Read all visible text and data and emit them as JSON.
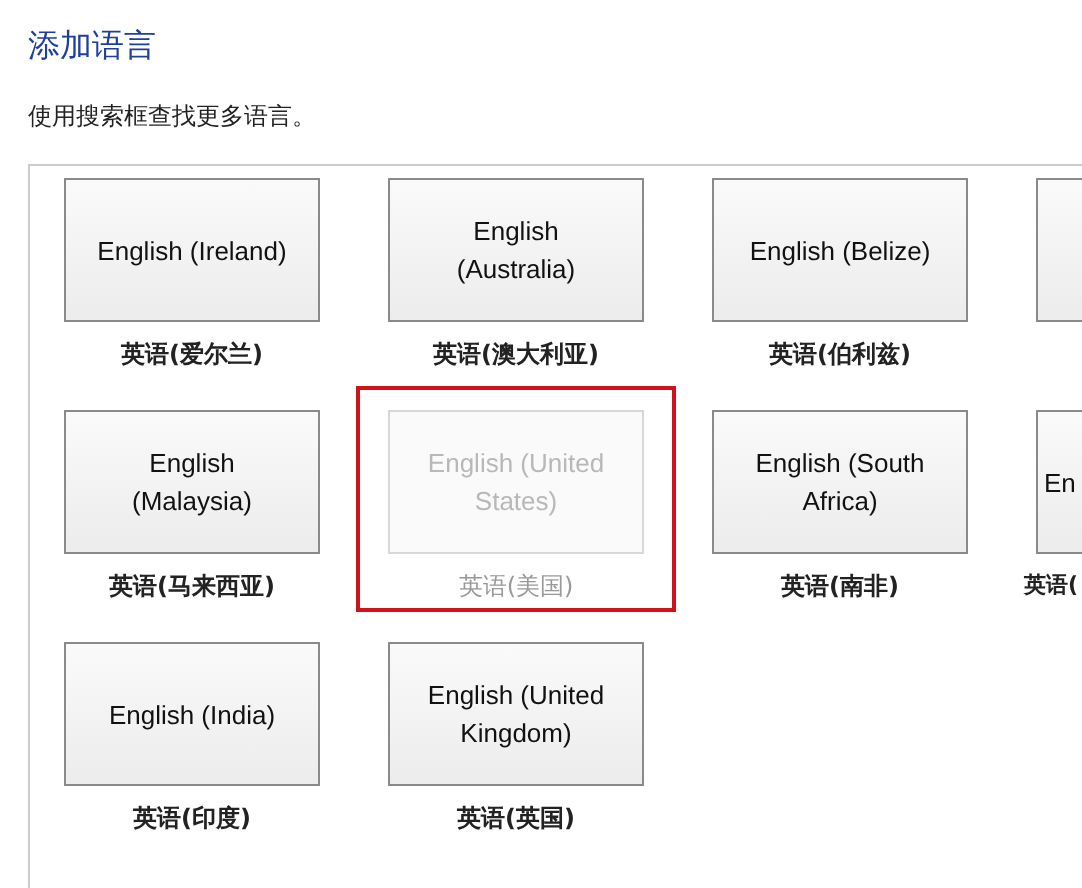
{
  "title": "添加语言",
  "instruction": "使用搜索框查找更多语言。",
  "languages": [
    {
      "kind": "full",
      "tile_text": "English (Ireland)",
      "caption": "英语(爱尔兰)",
      "disabled": false,
      "highlighted": false
    },
    {
      "kind": "full",
      "tile_text": "English (Australia)",
      "caption": "英语(澳大利亚)",
      "disabled": false,
      "highlighted": false
    },
    {
      "kind": "full",
      "tile_text": "English (Belize)",
      "caption": "英语(伯利兹)",
      "disabled": false,
      "highlighted": false
    },
    {
      "kind": "partial",
      "disabled": false,
      "highlighted": false
    },
    {
      "kind": "full",
      "tile_text": "English (Malaysia)",
      "caption": "英语(马来西亚)",
      "disabled": false,
      "highlighted": false
    },
    {
      "kind": "full",
      "tile_text": "English (United States)",
      "caption": "英语(美国)",
      "disabled": true,
      "highlighted": true
    },
    {
      "kind": "full",
      "tile_text": "English (South Africa)",
      "caption": "英语(南非)",
      "disabled": false,
      "highlighted": false
    },
    {
      "kind": "partial",
      "tile_text": "En",
      "caption": "英语(",
      "disabled": false,
      "highlighted": false
    },
    {
      "kind": "full",
      "tile_text": "English (India)",
      "caption": "英语(印度)",
      "disabled": false,
      "highlighted": false
    },
    {
      "kind": "full",
      "tile_text": "English (United Kingdom)",
      "caption": "英语(英国)",
      "disabled": false,
      "highlighted": false
    }
  ]
}
